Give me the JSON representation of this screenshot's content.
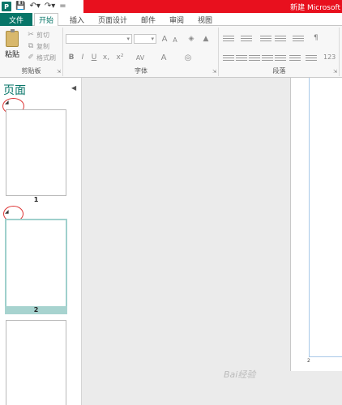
{
  "app": {
    "icon_letter": "P",
    "window_title": "新建 Microsoft",
    "colors": {
      "accent": "#077568",
      "title_bar": "#e8101e",
      "selected_thumb": "#a7d3cf"
    }
  },
  "qat": {
    "save_icon": "save-icon",
    "undo_icon": "undo-icon",
    "redo_icon": "redo-icon"
  },
  "tabs": [
    {
      "label": "文件"
    },
    {
      "label": "开始",
      "active": true
    },
    {
      "label": "插入"
    },
    {
      "label": "页面设计"
    },
    {
      "label": "邮件"
    },
    {
      "label": "审阅"
    },
    {
      "label": "视图"
    }
  ],
  "ribbon": {
    "clipboard": {
      "label": "剪贴板",
      "paste": "粘贴",
      "cut": "剪切",
      "copy": "复制",
      "format_painter": "格式刷"
    },
    "font": {
      "label": "字体",
      "bold": "B",
      "italic": "I",
      "underline": "U",
      "strike": "x,",
      "super": "x²",
      "font_color": "A",
      "grow": "A",
      "shrink": "A",
      "char_spacing": "AV"
    },
    "paragraph": {
      "label": "段落"
    }
  },
  "nav": {
    "title": "页面",
    "pages": [
      {
        "number": "1"
      },
      {
        "number": "2"
      },
      {
        "number": ""
      }
    ]
  },
  "canvas": {
    "page_number": "2"
  },
  "watermark": "Bai经验"
}
